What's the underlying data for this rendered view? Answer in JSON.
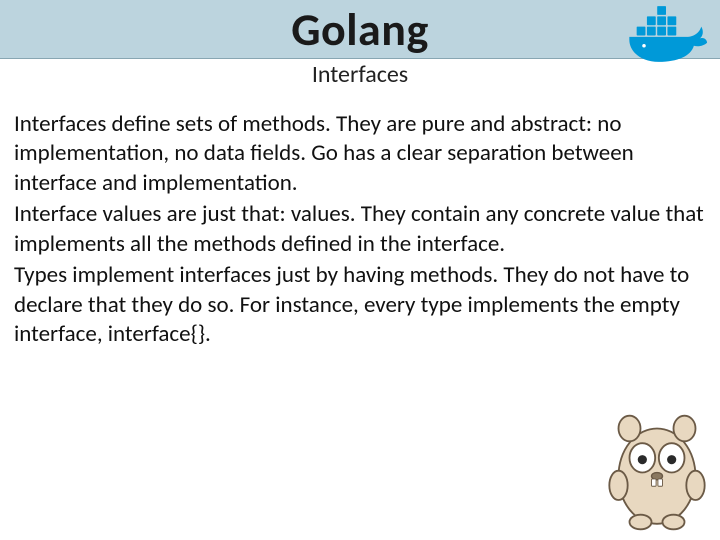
{
  "header": {
    "title": "Golang",
    "subtitle": "Interfaces"
  },
  "body": {
    "p1": "Interfaces define sets of methods. They are pure and abstract: no implementation, no data fields. Go has a clear separation between interface and implementation.",
    "p2": " Interface values are just that: values. They contain any concrete value that implements all the methods defined in the interface.",
    "p3": "Types implement interfaces just by having methods. They do not have to declare that they do so. For instance, every type implements the empty interface, interface{}."
  },
  "icons": {
    "docker": "docker-whale-icon",
    "gopher": "go-gopher-mascot"
  },
  "colors": {
    "band": "#bcd4de",
    "docker_blue": "#0099d8",
    "gopher_body": "#e8d8c0",
    "gopher_outline": "#6b5a46"
  }
}
